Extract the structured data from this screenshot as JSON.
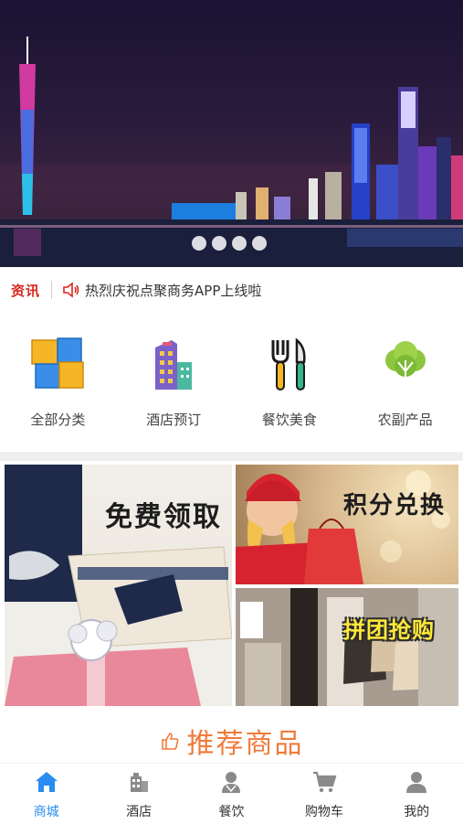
{
  "banner": {
    "slide_count": 4,
    "active_slide": 1
  },
  "news": {
    "tag": "资讯",
    "text": "热烈庆祝点聚商务APP上线啦"
  },
  "categories": [
    {
      "label": "全部分类",
      "icon": "blocks-icon"
    },
    {
      "label": "酒店预订",
      "icon": "hotel-building-icon"
    },
    {
      "label": "餐饮美食",
      "icon": "fork-knife-icon"
    },
    {
      "label": "农副产品",
      "icon": "vegetable-icon"
    }
  ],
  "promos": {
    "left_title": "免费领取",
    "right_top_title": "积分兑换",
    "right_bottom_title": "拼团抢购"
  },
  "recommend": {
    "title": "推荐商品"
  },
  "tabbar": {
    "items": [
      {
        "label": "商城",
        "icon": "home-icon",
        "active": true
      },
      {
        "label": "酒店",
        "icon": "hotel-icon",
        "active": false
      },
      {
        "label": "餐饮",
        "icon": "dining-icon",
        "active": false
      },
      {
        "label": "购物车",
        "icon": "cart-icon",
        "active": false
      },
      {
        "label": "我的",
        "icon": "profile-icon",
        "active": false
      }
    ]
  },
  "colors": {
    "accent": "#2a8cf0",
    "news_tag": "#d9261c",
    "recommend": "#f07a3b",
    "divider": "#efeff1"
  }
}
